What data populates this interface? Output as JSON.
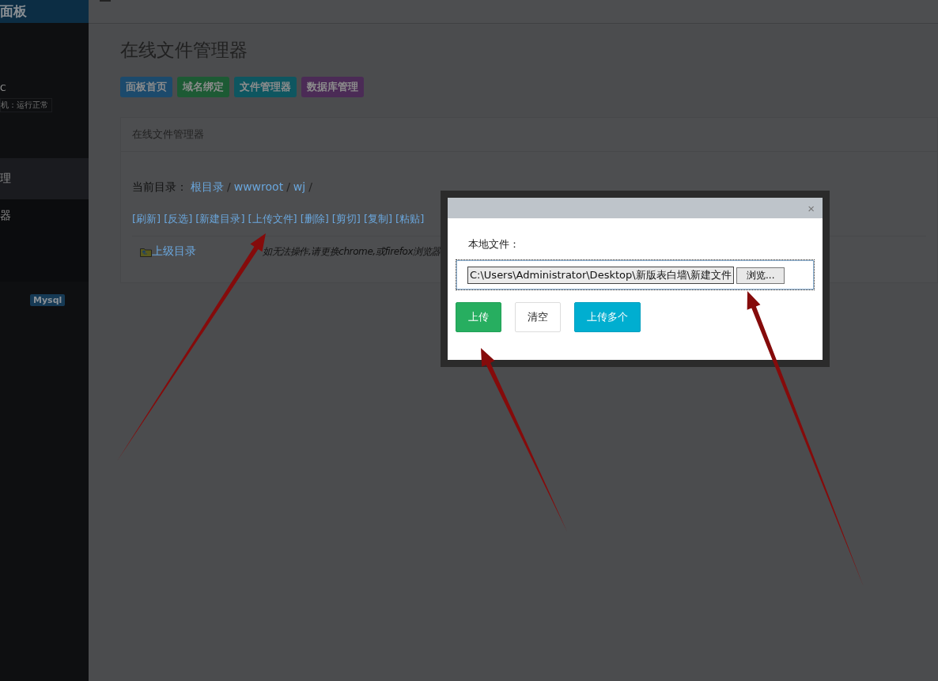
{
  "sidebar": {
    "brand": "面板",
    "user_name": "C",
    "status": "机：运行正常",
    "items": [
      {
        "label": "理",
        "selected": true
      },
      {
        "label": "器",
        "selected": false
      }
    ],
    "badge": "Mysql"
  },
  "page": {
    "title": "在线文件管理器",
    "nav_buttons": [
      {
        "label": "面板首页",
        "color": "#1c4a6c"
      },
      {
        "label": "域名绑定",
        "color": "#1d5a34"
      },
      {
        "label": "文件管理器",
        "color": "#0e5660"
      },
      {
        "label": "数据库管理",
        "color": "#4b2b56"
      }
    ]
  },
  "panel": {
    "heading": "在线文件管理器",
    "path_label": "当前目录：",
    "path": [
      {
        "label": "根目录",
        "separator": "/"
      },
      {
        "label": "wwwroot",
        "separator": "/"
      },
      {
        "label": "wj",
        "separator": "/"
      }
    ],
    "actions": [
      "[刷新]",
      "[反选]",
      "[新建目录]",
      "[上传文件]",
      "[删除]",
      "[剪切]",
      "[复制]",
      "[粘贴]"
    ],
    "parent_link": "上级目录",
    "notice": "如无法操作,请更换chrome,或firefox浏览器"
  },
  "dialog": {
    "close": "×",
    "label": "本地文件：",
    "file_value": "C:\\Users\\Administrator\\Desktop\\新版表白墙\\新建文件",
    "browse": "浏览...",
    "buttons": [
      {
        "label": "上传",
        "kind": "success"
      },
      {
        "label": "清空",
        "kind": "default"
      },
      {
        "label": "上传多个",
        "kind": "info"
      }
    ]
  }
}
